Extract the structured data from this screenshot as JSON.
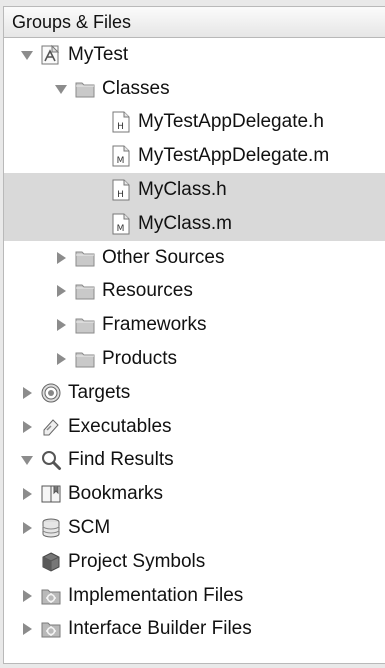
{
  "header": {
    "title": "Groups & Files"
  },
  "tree": [
    {
      "label": "MyTest",
      "depth": 0,
      "disclosure": "open",
      "icon": "project-app-icon"
    },
    {
      "label": "Classes",
      "depth": 1,
      "disclosure": "open",
      "icon": "folder-icon"
    },
    {
      "label": "MyTestAppDelegate.h",
      "depth": 2,
      "disclosure": "none",
      "icon": "header-file-icon",
      "letter": "H"
    },
    {
      "label": "MyTestAppDelegate.m",
      "depth": 2,
      "disclosure": "none",
      "icon": "implementation-file-icon",
      "letter": "M"
    },
    {
      "label": "MyClass.h",
      "depth": 2,
      "disclosure": "none",
      "icon": "header-file-icon",
      "letter": "H",
      "selected": true
    },
    {
      "label": "MyClass.m",
      "depth": 2,
      "disclosure": "none",
      "icon": "implementation-file-icon",
      "letter": "M",
      "selected": true
    },
    {
      "label": "Other Sources",
      "depth": 1,
      "disclosure": "closed",
      "icon": "folder-icon"
    },
    {
      "label": "Resources",
      "depth": 1,
      "disclosure": "closed",
      "icon": "folder-icon"
    },
    {
      "label": "Frameworks",
      "depth": 1,
      "disclosure": "closed",
      "icon": "folder-icon"
    },
    {
      "label": "Products",
      "depth": 1,
      "disclosure": "closed",
      "icon": "folder-icon"
    },
    {
      "label": "Targets",
      "depth": 0,
      "disclosure": "closed",
      "icon": "target-icon"
    },
    {
      "label": "Executables",
      "depth": 0,
      "disclosure": "closed",
      "icon": "executable-icon"
    },
    {
      "label": "Find Results",
      "depth": 0,
      "disclosure": "open",
      "icon": "magnifier-icon"
    },
    {
      "label": "Bookmarks",
      "depth": 0,
      "disclosure": "closed",
      "icon": "bookmarks-icon"
    },
    {
      "label": "SCM",
      "depth": 0,
      "disclosure": "closed",
      "icon": "database-icon"
    },
    {
      "label": "Project Symbols",
      "depth": 0,
      "disclosure": "none",
      "icon": "cube-icon"
    },
    {
      "label": "Implementation Files",
      "depth": 0,
      "disclosure": "closed",
      "icon": "smart-group-icon"
    },
    {
      "label": "Interface Builder Files",
      "depth": 0,
      "disclosure": "closed",
      "icon": "smart-group-icon"
    }
  ],
  "colors": {
    "selection": "#d9d9d9",
    "folder": "#c9c9c9",
    "text": "#111111"
  }
}
